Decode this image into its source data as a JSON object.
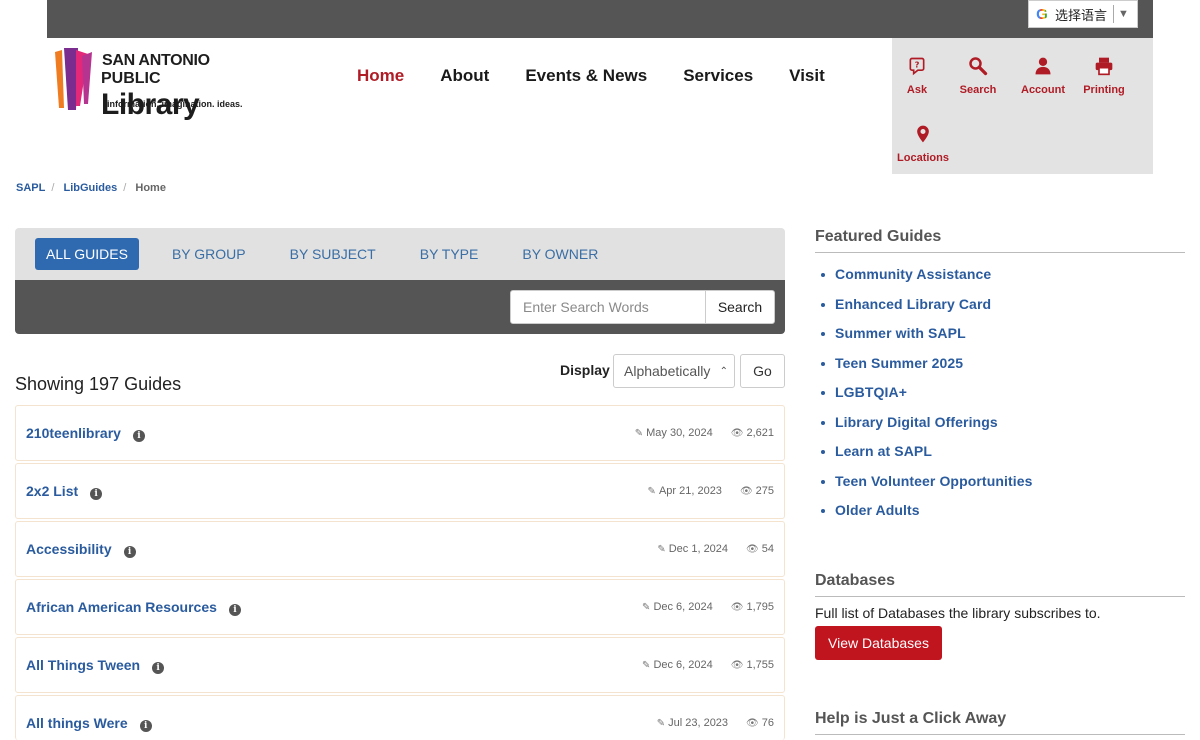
{
  "translate": {
    "label": "选择语言",
    "icon": "google-g-icon"
  },
  "logo": {
    "line1": "SAN ANTONIO",
    "line2a": "PUBLIC",
    "line2b": "Library",
    "tagline": "information. imagination. ideas."
  },
  "nav": {
    "items": [
      "Home",
      "About",
      "Events & News",
      "Services",
      "Visit"
    ],
    "active": "Home"
  },
  "quick_links": [
    {
      "label": "Ask",
      "icon": "ask-icon"
    },
    {
      "label": "Search",
      "icon": "search-icon"
    },
    {
      "label": "Account",
      "icon": "account-icon"
    },
    {
      "label": "Printing",
      "icon": "printer-icon"
    },
    {
      "label": "Locations",
      "icon": "map-pin-icon"
    }
  ],
  "breadcrumb": [
    "SAPL",
    "LibGuides",
    "Home"
  ],
  "tabs": [
    "ALL GUIDES",
    "BY GROUP",
    "BY SUBJECT",
    "BY TYPE",
    "BY OWNER"
  ],
  "search": {
    "placeholder": "Enter Search Words",
    "button": "Search"
  },
  "showing": "Showing 197 Guides",
  "display": {
    "label": "Display",
    "selected": "Alphabetically",
    "go": "Go"
  },
  "guides": [
    {
      "name": "210teenlibrary",
      "date": "May 30, 2024",
      "views": "2,621"
    },
    {
      "name": "2x2 List",
      "date": "Apr 21, 2023",
      "views": "275"
    },
    {
      "name": "Accessibility",
      "date": "Dec 1, 2024",
      "views": "54"
    },
    {
      "name": "African American Resources",
      "date": "Dec 6, 2024",
      "views": "1,795"
    },
    {
      "name": "All Things Tween",
      "date": "Dec 6, 2024",
      "views": "1,755"
    },
    {
      "name": "All things Were",
      "date": "Jul 23, 2023",
      "views": "76"
    }
  ],
  "featured": {
    "title": "Featured Guides",
    "items": [
      "Community Assistance",
      "Enhanced Library Card",
      "Summer with SAPL",
      "Teen Summer 2025",
      "LGBTQIA+",
      "Library Digital Offerings",
      "Learn at SAPL",
      "Teen Volunteer Opportunities",
      "Older Adults"
    ]
  },
  "databases": {
    "title": "Databases",
    "text": "Full list of Databases the library subscribes to.",
    "button": "View Databases"
  },
  "help": {
    "title": "Help is Just a Click Away"
  },
  "colors": {
    "accent_red": "#b01c26",
    "link_blue": "#2a5b9e",
    "tab_active": "#2f6ab0",
    "dark_bar": "#555555"
  }
}
